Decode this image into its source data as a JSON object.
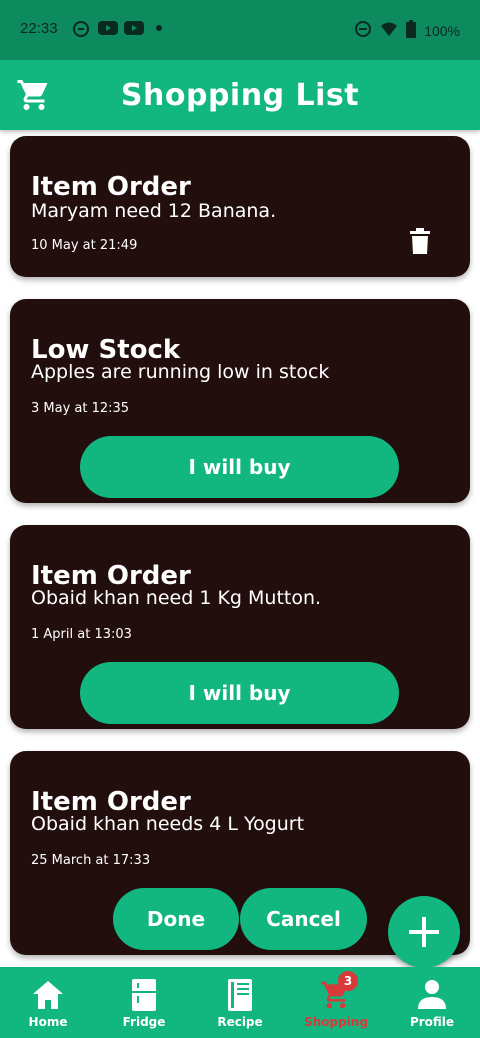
{
  "status_bar": {
    "time": "22:33",
    "battery": "100%",
    "left_icons": [
      "sync-icon",
      "youtube-icon",
      "youtube-icon",
      "dot-icon"
    ],
    "right_icons": [
      "dnd-icon",
      "wifi-icon",
      "battery-icon"
    ]
  },
  "app_bar": {
    "title": "Shopping List",
    "icon": "shopping-cart-icon"
  },
  "cards": [
    {
      "title": "Item Order",
      "message": "Maryam need 12  Banana.",
      "date": "10 May at 21:49",
      "action": "delete"
    },
    {
      "title": "Low Stock",
      "message": "Apples are running low in stock",
      "date": "3 May at 12:35",
      "button_label": "I will buy"
    },
    {
      "title": "Item Order",
      "message": "Obaid khan need 1 Kg Mutton.",
      "date": "1 April at 13:03",
      "button_label": "I will buy"
    },
    {
      "title": "Item Order",
      "message": "Obaid khan needs 4 L Yogurt",
      "date": "25 March at 17:33",
      "done_label": "Done",
      "cancel_label": "Cancel"
    }
  ],
  "fab": {
    "icon": "plus-icon"
  },
  "bottom_nav": {
    "items": [
      {
        "label": "Home",
        "icon": "home-icon"
      },
      {
        "label": "Fridge",
        "icon": "fridge-icon"
      },
      {
        "label": "Recipe",
        "icon": "book-icon"
      },
      {
        "label": "Shopping",
        "icon": "shopping-cart-icon",
        "badge": "3",
        "active": true
      },
      {
        "label": "Profile",
        "icon": "person-icon"
      }
    ]
  },
  "colors": {
    "primary": "#12b67f",
    "status_bar": "#0e8a5f",
    "card": "#230e0e",
    "active_nav": "#d9393a",
    "badge": "#d9393a"
  }
}
